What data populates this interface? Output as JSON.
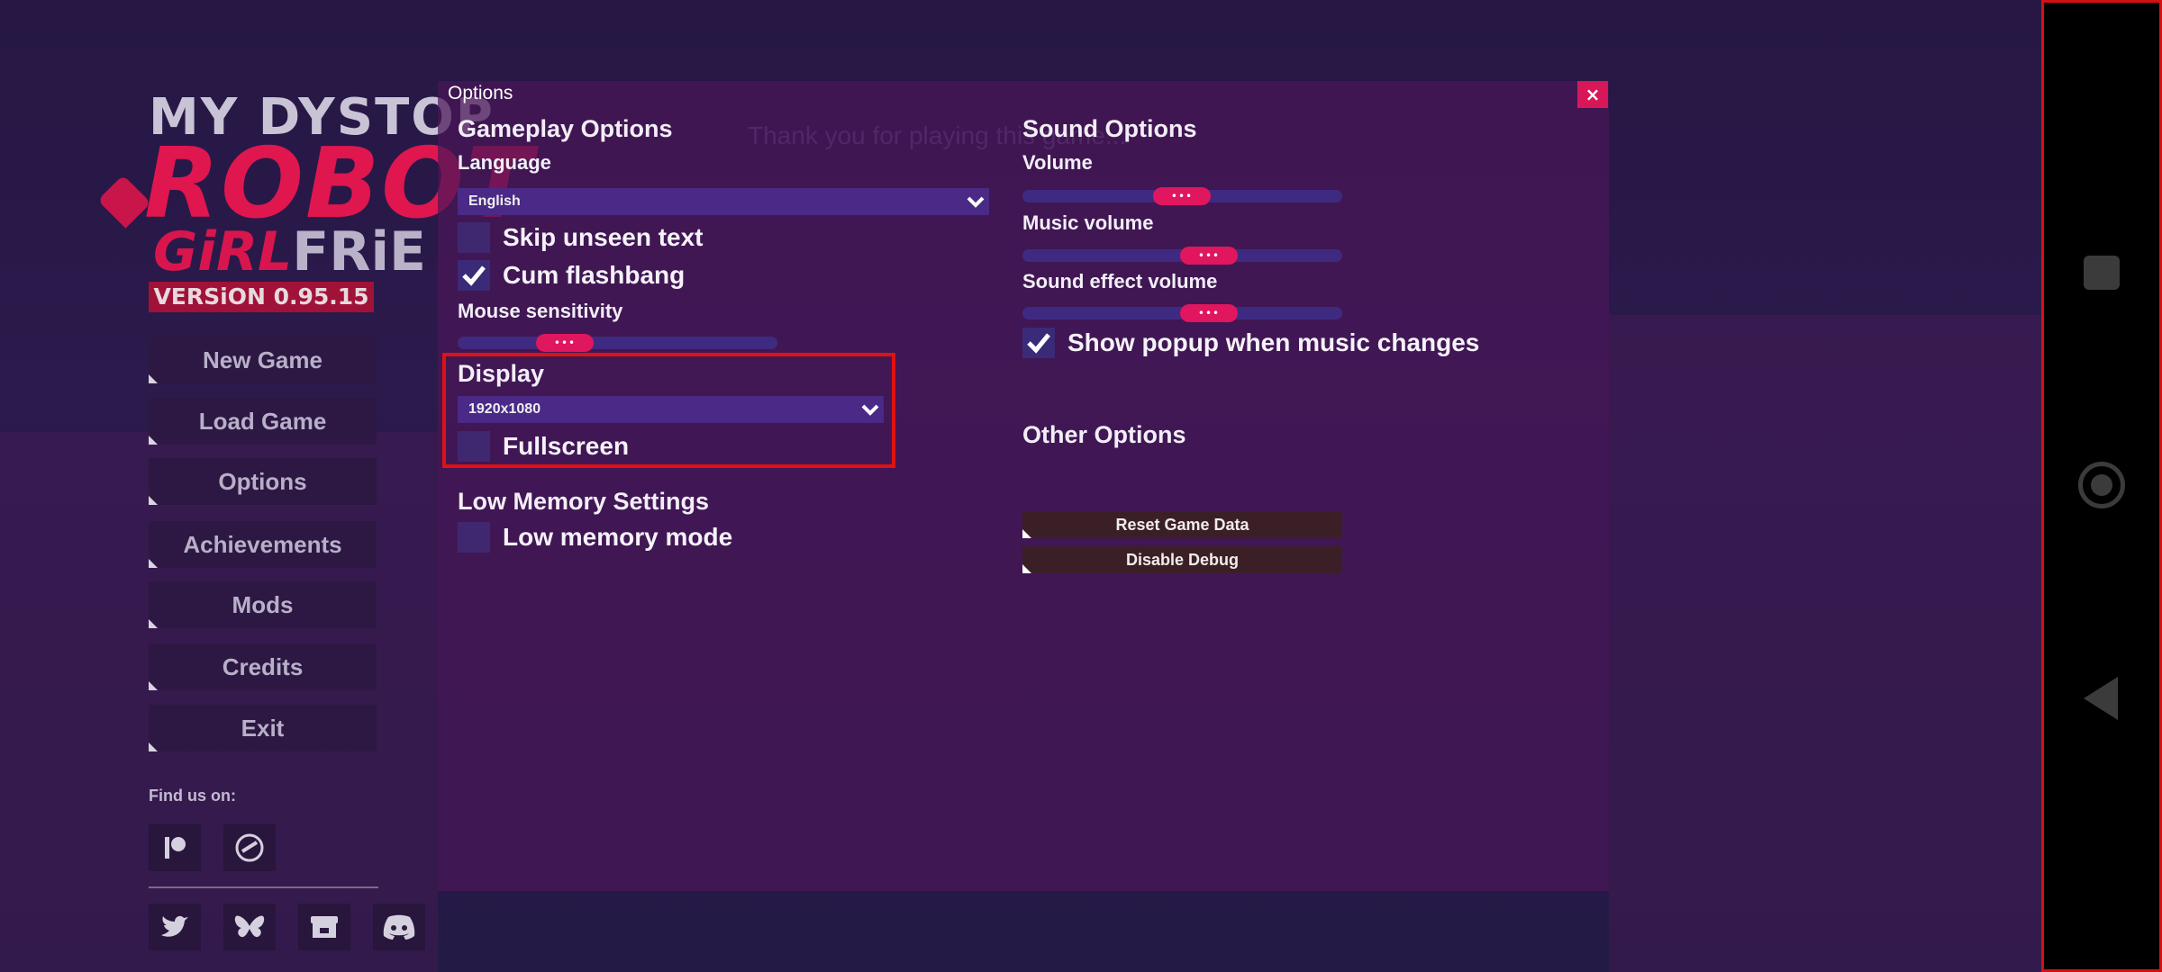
{
  "logo": {
    "line1": "MY DYSTOP",
    "line2": "ROBOT",
    "line3_a": "GiRL",
    "line3_b": "FRiE",
    "version": "VERSiON 0.95.15"
  },
  "menu": [
    {
      "label": "New Game"
    },
    {
      "label": "Load Game"
    },
    {
      "label": "Options"
    },
    {
      "label": "Achievements"
    },
    {
      "label": "Mods"
    },
    {
      "label": "Credits"
    },
    {
      "label": "Exit"
    }
  ],
  "find_us": "Find us on:",
  "social": [
    "patreon-icon",
    "discord-alt-icon",
    "twitter-icon",
    "bluesky-icon",
    "itchio-icon",
    "discord-icon"
  ],
  "dialog": {
    "title": "Options",
    "close": "×",
    "gameplay": {
      "heading": "Gameplay Options",
      "language_label": "Language",
      "language_value": "English",
      "skip_unseen": "Skip unseen text",
      "skip_unseen_checked": false,
      "cum_flashbang": "Cum flashbang",
      "cum_flashbang_checked": true,
      "mouse_label": "Mouse sensitivity",
      "mouse_value": 0.35
    },
    "display": {
      "heading": "Display",
      "resolution": "1920x1080",
      "fullscreen": "Fullscreen",
      "fullscreen_checked": false
    },
    "memory": {
      "heading": "Low Memory Settings",
      "low_memory": "Low memory mode",
      "low_memory_checked": false
    },
    "sound": {
      "heading": "Sound Options",
      "volume_label": "Volume",
      "volume_value": 0.5,
      "music_label": "Music volume",
      "music_value": 0.6,
      "sfx_label": "Sound effect volume",
      "sfx_value": 0.6,
      "popup_label": "Show popup when music changes",
      "popup_checked": true
    },
    "other": {
      "heading": "Other Options",
      "reset": "Reset Game Data",
      "debug": "Disable Debug"
    },
    "thumb_text": "•••"
  },
  "colors": {
    "accent": "#e0165e",
    "panel": "#4a2a86",
    "highlight": "#e01111"
  }
}
